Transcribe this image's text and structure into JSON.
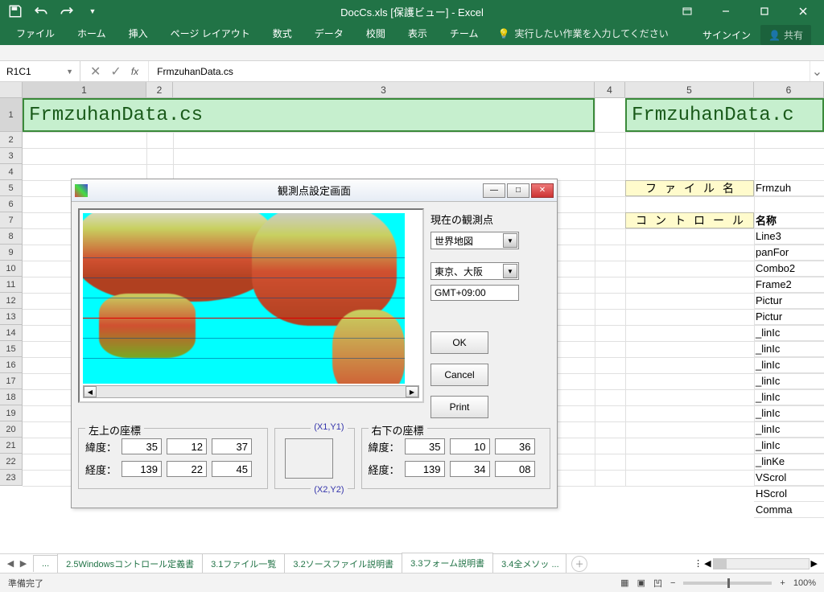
{
  "titlebar": {
    "title": "DocCs.xls  [保護ビュー] - Excel"
  },
  "ribbon": {
    "tabs": [
      "ファイル",
      "ホーム",
      "挿入",
      "ページ レイアウト",
      "数式",
      "データ",
      "校閲",
      "表示",
      "チーム"
    ],
    "tell_me": "実行したい作業を入力してください",
    "signin": "サインイン",
    "share": "共有"
  },
  "formula_bar": {
    "name_box": "R1C1",
    "value": "FrmzuhanData.cs"
  },
  "columns": [
    "1",
    "2",
    "3",
    "4",
    "5",
    "6"
  ],
  "big_cell_1": "FrmzuhanData.cs",
  "big_cell_2": "FrmzuhanData.c",
  "yellow1": "ファイル名",
  "yellow2": "コントロール",
  "col_e_header_file": "Frmzuh",
  "col_e_name_header": "名称",
  "col_e_items": [
    "Line3",
    "panFor",
    "Combo2",
    "Frame2",
    "Pictur",
    "Pictur",
    "_linIc",
    "_linIc",
    "_linIc",
    "_linIc",
    "_linIc",
    "_linIc",
    "_linIc",
    "_linIc",
    "_linKe",
    "VScrol",
    "HScrol",
    "Comma"
  ],
  "dialog": {
    "title": "観測点設定画面",
    "group_current": "現在の観測点",
    "combo_map": "世界地図",
    "combo_city": "東京、大阪",
    "gmt": "GMT+09:00",
    "ok": "OK",
    "cancel": "Cancel",
    "print": "Print",
    "group_tl": "左上の座標",
    "group_br": "右下の座標",
    "lat_label": "緯度：",
    "lon_label": "経度：",
    "tl_lat": [
      "35",
      "12",
      "37"
    ],
    "tl_lon": [
      "139",
      "22",
      "45"
    ],
    "br_lat": [
      "35",
      "10",
      "36"
    ],
    "br_lon": [
      "139",
      "34",
      "08"
    ],
    "xy1": "(X1,Y1)",
    "xy2": "(X2,Y2)"
  },
  "sheets": {
    "overflow": "...",
    "tabs": [
      "2.5Windowsコントロール定義書",
      "3.1ファイル一覧",
      "3.2ソースファイル説明書",
      "3.3フォーム説明書",
      "3.4全メソッ"
    ],
    "active_index": 3,
    "more": "..."
  },
  "status": {
    "ready": "準備完了",
    "zoom": "100%"
  }
}
